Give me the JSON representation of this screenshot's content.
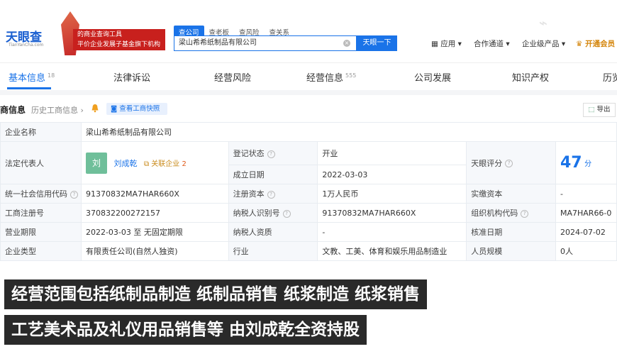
{
  "header": {
    "logo_text": "天眼查",
    "logo_sub": "TianYanCha.com",
    "slogan_line1": "的商业查询工具",
    "slogan_line2": "平价企业发展子基金旗下机构",
    "search_tabs": [
      "查公司",
      "查老板",
      "查风险",
      "查关系"
    ],
    "search_value": "梁山希希纸制品有限公司",
    "search_button": "天眼一下",
    "nav": [
      "应用",
      "合作通道",
      "企业级产品"
    ],
    "vip": "开通会员"
  },
  "tabs": [
    {
      "label": "基本信息",
      "count": "18"
    },
    {
      "label": "法律诉讼",
      "count": ""
    },
    {
      "label": "经营风险",
      "count": ""
    },
    {
      "label": "经营信息",
      "count": "555"
    },
    {
      "label": "公司发展",
      "count": ""
    },
    {
      "label": "知识产权",
      "count": ""
    },
    {
      "label": "历览",
      "count": ""
    }
  ],
  "section": {
    "title": "商信息",
    "history": "历史工商信息",
    "snapshot": "查看工商快照",
    "export": "导出"
  },
  "info": {
    "company_name_label": "企业名称",
    "company_name": "梁山希希纸制品有限公司",
    "legal_rep_label": "法定代表人",
    "legal_rep_avatar": "刘",
    "legal_rep_name": "刘成乾",
    "legal_rep_assoc": "关联企业",
    "legal_rep_assoc_count": "2",
    "reg_status_label": "登记状态",
    "reg_status": "开业",
    "tianyan_score_label": "天眼评分",
    "tianyan_score": "47",
    "tianyan_score_unit": "分",
    "founded_label": "成立日期",
    "founded": "2022-03-03",
    "credit_code_label": "统一社会信用代码",
    "credit_code": "91370832MA7HAR660X",
    "reg_capital_label": "注册资本",
    "reg_capital": "1万人民币",
    "paid_capital_label": "实缴资本",
    "paid_capital": "-",
    "reg_no_label": "工商注册号",
    "reg_no": "370832200272157",
    "taxpayer_id_label": "纳税人识别号",
    "taxpayer_id": "91370832MA7HAR660X",
    "org_code_label": "组织机构代码",
    "org_code": "MA7HAR66-0",
    "term_label": "营业期限",
    "term": "2022-03-03 至 无固定期限",
    "taxpayer_qual_label": "纳税人资质",
    "taxpayer_qual": "-",
    "approve_date_label": "核准日期",
    "approve_date": "2024-07-02",
    "type_label": "企业类型",
    "type": "有限责任公司(自然人独资)",
    "industry_label": "行业",
    "industry": "文教、工美、体育和娱乐用品制造业",
    "staff_label": "人员规模",
    "staff": "0人"
  },
  "captions": [
    "经营范围包括纸制品制造 纸制品销售 纸浆制造 纸浆销售",
    "工艺美术品及礼仪用品销售等 由刘成乾全资持股"
  ]
}
